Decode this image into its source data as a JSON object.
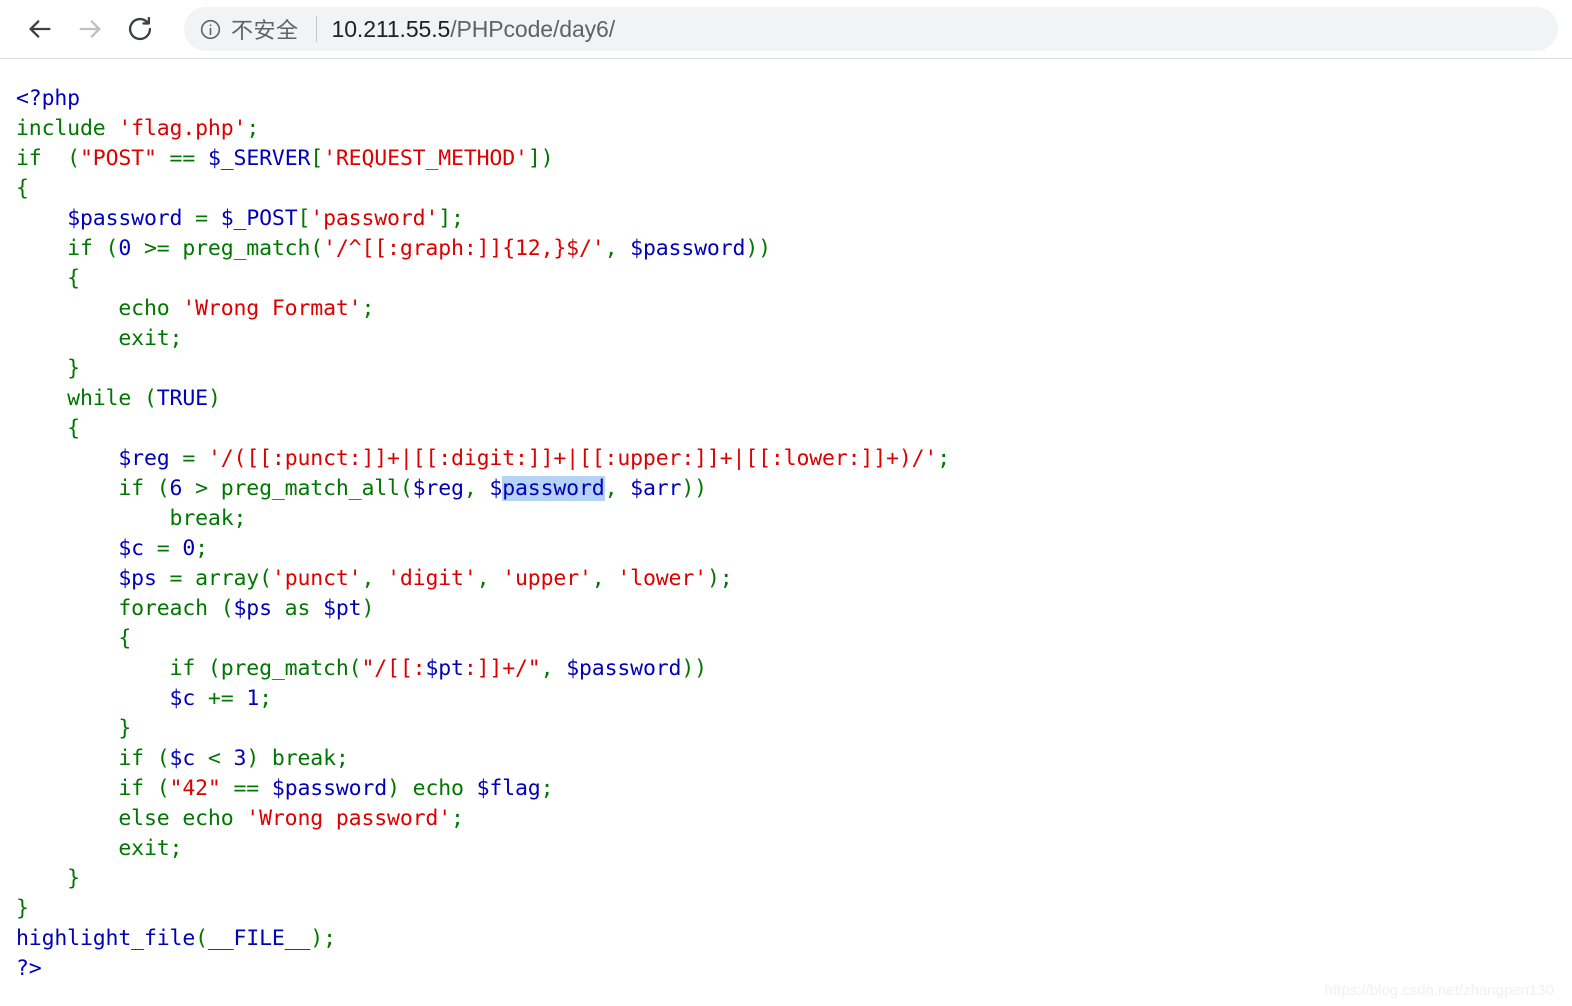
{
  "browser": {
    "back_button": "back-arrow",
    "forward_button": "forward-arrow",
    "reload_button": "reload",
    "info_icon": "info-circle-icon",
    "security_label": "不安全",
    "url_host": "10.211.55.5",
    "url_path": "/PHPcode/day6/",
    "url_full": "10.211.55.5/PHPcode/day6/"
  },
  "colors": {
    "php_default": "#0000BB",
    "php_keyword": "#007700",
    "php_string": "#DD0000",
    "selection": "#b5d3f5",
    "toolbar_bg": "#ffffff",
    "omnibox_bg": "#f1f3f4",
    "url_host_color": "#202124",
    "url_path_color": "#5f6368",
    "page_bg": "#ffffff"
  },
  "code": {
    "language": "php",
    "selected_text": "password",
    "lines": [
      [
        {
          "t": "<?php",
          "c": "default"
        }
      ],
      [
        {
          "t": "include ",
          "c": "keyword"
        },
        {
          "t": "'flag.php'",
          "c": "string"
        },
        {
          "t": ";",
          "c": "keyword"
        }
      ],
      [
        {
          "t": "if  (",
          "c": "keyword"
        },
        {
          "t": "\"POST\"",
          "c": "string"
        },
        {
          "t": " == ",
          "c": "keyword"
        },
        {
          "t": "$_SERVER",
          "c": "var"
        },
        {
          "t": "[",
          "c": "keyword"
        },
        {
          "t": "'REQUEST_METHOD'",
          "c": "string"
        },
        {
          "t": "])",
          "c": "keyword"
        }
      ],
      [
        {
          "t": "{",
          "c": "keyword"
        }
      ],
      [
        {
          "t": "    ",
          "c": "keyword"
        },
        {
          "t": "$password",
          "c": "var"
        },
        {
          "t": " = ",
          "c": "keyword"
        },
        {
          "t": "$_POST",
          "c": "var"
        },
        {
          "t": "[",
          "c": "keyword"
        },
        {
          "t": "'password'",
          "c": "string"
        },
        {
          "t": "];",
          "c": "keyword"
        }
      ],
      [
        {
          "t": "    if (",
          "c": "keyword"
        },
        {
          "t": "0",
          "c": "default"
        },
        {
          "t": " >= preg_match(",
          "c": "keyword"
        },
        {
          "t": "'/^[[:graph:]]{12,}$/'",
          "c": "string"
        },
        {
          "t": ", ",
          "c": "keyword"
        },
        {
          "t": "$password",
          "c": "var"
        },
        {
          "t": "))",
          "c": "keyword"
        }
      ],
      [
        {
          "t": "    {",
          "c": "keyword"
        }
      ],
      [
        {
          "t": "        echo ",
          "c": "keyword"
        },
        {
          "t": "'Wrong Format'",
          "c": "string"
        },
        {
          "t": ";",
          "c": "keyword"
        }
      ],
      [
        {
          "t": "        exit;",
          "c": "keyword"
        }
      ],
      [
        {
          "t": "    }",
          "c": "keyword"
        }
      ],
      [
        {
          "t": "    while (",
          "c": "keyword"
        },
        {
          "t": "TRUE",
          "c": "default"
        },
        {
          "t": ")",
          "c": "keyword"
        }
      ],
      [
        {
          "t": "    {",
          "c": "keyword"
        }
      ],
      [
        {
          "t": "        ",
          "c": "keyword"
        },
        {
          "t": "$reg",
          "c": "var"
        },
        {
          "t": " = ",
          "c": "keyword"
        },
        {
          "t": "'/([[:punct:]]+|[[:digit:]]+|[[:upper:]]+|[[:lower:]]+)/'",
          "c": "string"
        },
        {
          "t": ";",
          "c": "keyword"
        }
      ],
      [
        {
          "t": "        if (",
          "c": "keyword"
        },
        {
          "t": "6",
          "c": "default"
        },
        {
          "t": " > preg_match_all(",
          "c": "keyword"
        },
        {
          "t": "$reg",
          "c": "var"
        },
        {
          "t": ", ",
          "c": "keyword"
        },
        {
          "t": "$",
          "c": "var"
        },
        {
          "t": "password",
          "c": "var",
          "sel": true
        },
        {
          "t": ", ",
          "c": "keyword"
        },
        {
          "t": "$arr",
          "c": "var"
        },
        {
          "t": "))",
          "c": "keyword"
        }
      ],
      [
        {
          "t": "            break;",
          "c": "keyword"
        }
      ],
      [
        {
          "t": "        ",
          "c": "keyword"
        },
        {
          "t": "$c",
          "c": "var"
        },
        {
          "t": " = ",
          "c": "keyword"
        },
        {
          "t": "0",
          "c": "default"
        },
        {
          "t": ";",
          "c": "keyword"
        }
      ],
      [
        {
          "t": "        ",
          "c": "keyword"
        },
        {
          "t": "$ps",
          "c": "var"
        },
        {
          "t": " = array(",
          "c": "keyword"
        },
        {
          "t": "'punct'",
          "c": "string"
        },
        {
          "t": ", ",
          "c": "keyword"
        },
        {
          "t": "'digit'",
          "c": "string"
        },
        {
          "t": ", ",
          "c": "keyword"
        },
        {
          "t": "'upper'",
          "c": "string"
        },
        {
          "t": ", ",
          "c": "keyword"
        },
        {
          "t": "'lower'",
          "c": "string"
        },
        {
          "t": ");",
          "c": "keyword"
        }
      ],
      [
        {
          "t": "        foreach (",
          "c": "keyword"
        },
        {
          "t": "$ps",
          "c": "var"
        },
        {
          "t": " as ",
          "c": "keyword"
        },
        {
          "t": "$pt",
          "c": "var"
        },
        {
          "t": ")",
          "c": "keyword"
        }
      ],
      [
        {
          "t": "        {",
          "c": "keyword"
        }
      ],
      [
        {
          "t": "            if (preg_match(",
          "c": "keyword"
        },
        {
          "t": "\"/[[:",
          "c": "string"
        },
        {
          "t": "$pt",
          "c": "var"
        },
        {
          "t": ":]]+/\"",
          "c": "string"
        },
        {
          "t": ", ",
          "c": "keyword"
        },
        {
          "t": "$password",
          "c": "var"
        },
        {
          "t": "))",
          "c": "keyword"
        }
      ],
      [
        {
          "t": "            ",
          "c": "keyword"
        },
        {
          "t": "$c",
          "c": "var"
        },
        {
          "t": " += ",
          "c": "keyword"
        },
        {
          "t": "1",
          "c": "default"
        },
        {
          "t": ";",
          "c": "keyword"
        }
      ],
      [
        {
          "t": "        }",
          "c": "keyword"
        }
      ],
      [
        {
          "t": "        if (",
          "c": "keyword"
        },
        {
          "t": "$c",
          "c": "var"
        },
        {
          "t": " < ",
          "c": "keyword"
        },
        {
          "t": "3",
          "c": "default"
        },
        {
          "t": ") break;",
          "c": "keyword"
        }
      ],
      [
        {
          "t": "        if (",
          "c": "keyword"
        },
        {
          "t": "\"42\"",
          "c": "string"
        },
        {
          "t": " == ",
          "c": "keyword"
        },
        {
          "t": "$password",
          "c": "var"
        },
        {
          "t": ") echo ",
          "c": "keyword"
        },
        {
          "t": "$flag",
          "c": "var"
        },
        {
          "t": ";",
          "c": "keyword"
        }
      ],
      [
        {
          "t": "        else echo ",
          "c": "keyword"
        },
        {
          "t": "'Wrong password'",
          "c": "string"
        },
        {
          "t": ";",
          "c": "keyword"
        }
      ],
      [
        {
          "t": "        exit;",
          "c": "keyword"
        }
      ],
      [
        {
          "t": "    }",
          "c": "keyword"
        }
      ],
      [
        {
          "t": "}",
          "c": "keyword"
        }
      ],
      [
        {
          "t": "highlight_file",
          "c": "default"
        },
        {
          "t": "(",
          "c": "keyword"
        },
        {
          "t": "__FILE__",
          "c": "default"
        },
        {
          "t": ");",
          "c": "keyword"
        }
      ],
      [
        {
          "t": "?>",
          "c": "default"
        }
      ]
    ]
  },
  "watermark": {
    "text": "https://blog.csdn.net/zhangpen130"
  }
}
